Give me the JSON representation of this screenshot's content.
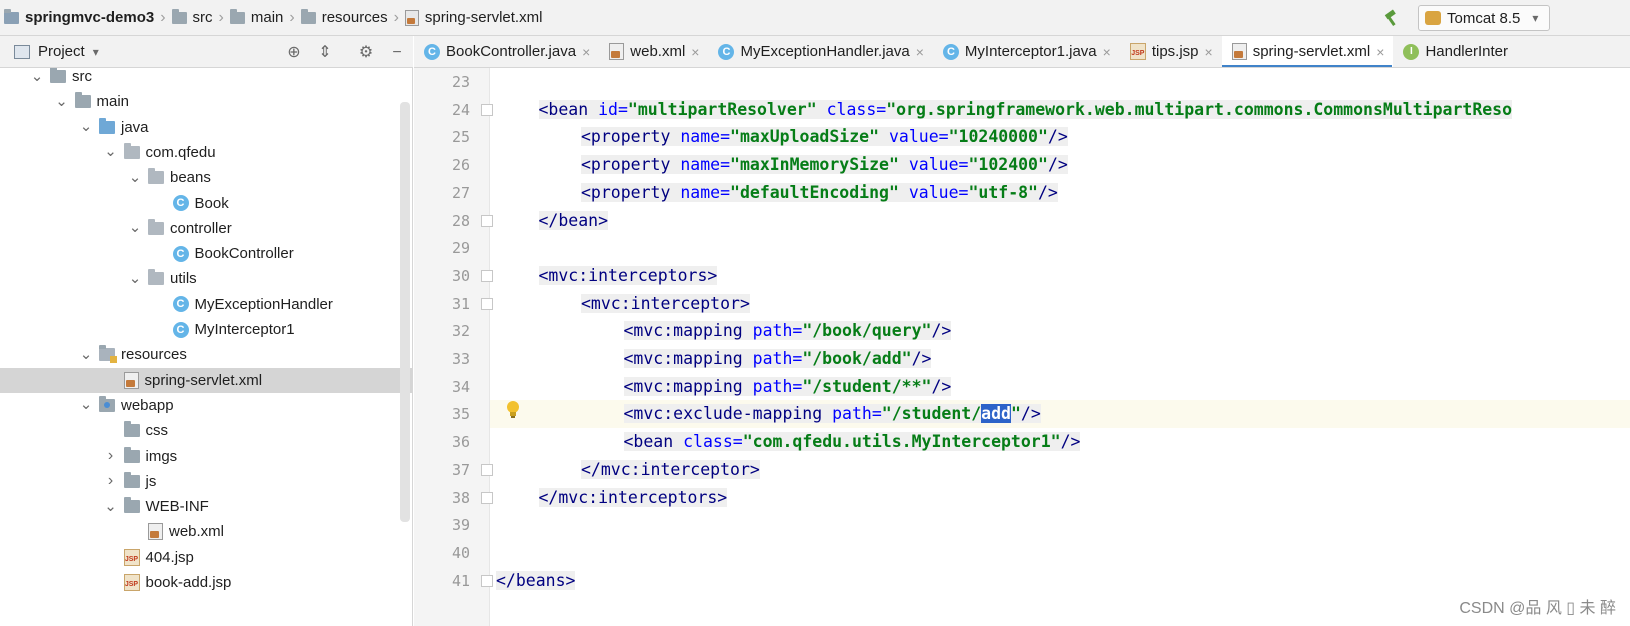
{
  "breadcrumb": {
    "project": "springmvc-demo3",
    "items": [
      "src",
      "main",
      "resources",
      "spring-servlet.xml"
    ]
  },
  "run_config": {
    "label": "Tomcat 8.5"
  },
  "project_panel": {
    "title": "Project"
  },
  "tree": [
    {
      "label": "src",
      "depth": 0,
      "icon": "folder",
      "arrow": "expanded"
    },
    {
      "label": "main",
      "depth": 1,
      "icon": "folder",
      "arrow": "expanded"
    },
    {
      "label": "java",
      "depth": 2,
      "icon": "source-folder",
      "arrow": "expanded"
    },
    {
      "label": "com.qfedu",
      "depth": 3,
      "icon": "package",
      "arrow": "expanded"
    },
    {
      "label": "beans",
      "depth": 4,
      "icon": "package",
      "arrow": "expanded"
    },
    {
      "label": "Book",
      "depth": 5,
      "icon": "class",
      "arrow": "none"
    },
    {
      "label": "controller",
      "depth": 4,
      "icon": "package",
      "arrow": "expanded"
    },
    {
      "label": "BookController",
      "depth": 5,
      "icon": "class",
      "arrow": "none"
    },
    {
      "label": "utils",
      "depth": 4,
      "icon": "package",
      "arrow": "expanded"
    },
    {
      "label": "MyExceptionHandler",
      "depth": 5,
      "icon": "class",
      "arrow": "none"
    },
    {
      "label": "MyInterceptor1",
      "depth": 5,
      "icon": "class",
      "arrow": "none"
    },
    {
      "label": "resources",
      "depth": 2,
      "icon": "resources-folder",
      "arrow": "expanded"
    },
    {
      "label": "spring-servlet.xml",
      "depth": 3,
      "icon": "xml",
      "arrow": "none",
      "selected": true
    },
    {
      "label": "webapp",
      "depth": 2,
      "icon": "web-folder",
      "arrow": "expanded"
    },
    {
      "label": "css",
      "depth": 3,
      "icon": "folder",
      "arrow": "none"
    },
    {
      "label": "imgs",
      "depth": 3,
      "icon": "folder",
      "arrow": "collapsed"
    },
    {
      "label": "js",
      "depth": 3,
      "icon": "folder",
      "arrow": "collapsed"
    },
    {
      "label": "WEB-INF",
      "depth": 3,
      "icon": "folder",
      "arrow": "expanded"
    },
    {
      "label": "web.xml",
      "depth": 4,
      "icon": "xml",
      "arrow": "none"
    },
    {
      "label": "404.jsp",
      "depth": 3,
      "icon": "jsp",
      "arrow": "none"
    },
    {
      "label": "book-add.jsp",
      "depth": 3,
      "icon": "jsp",
      "arrow": "none"
    }
  ],
  "tabs": [
    {
      "label": "BookController.java",
      "icon": "class",
      "closable": true
    },
    {
      "label": "web.xml",
      "icon": "xml",
      "closable": true
    },
    {
      "label": "MyExceptionHandler.java",
      "icon": "class",
      "closable": true
    },
    {
      "label": "MyInterceptor1.java",
      "icon": "class",
      "closable": true
    },
    {
      "label": "tips.jsp",
      "icon": "jsp",
      "closable": true
    },
    {
      "label": "spring-servlet.xml",
      "icon": "xml",
      "closable": true,
      "active": true
    },
    {
      "label": "HandlerInter",
      "icon": "interface",
      "closable": false
    }
  ],
  "editor": {
    "current_line": 35,
    "lines": [
      {
        "n": "23",
        "indent": 0,
        "tokens": []
      },
      {
        "n": "24",
        "indent": 1,
        "tokens": [
          [
            "t",
            "<bean "
          ],
          [
            "a",
            "id="
          ],
          [
            "v",
            "\"multipartResolver\""
          ],
          [
            "p",
            " "
          ],
          [
            "a",
            "class="
          ],
          [
            "v",
            "\"org.springframework.web.multipart.commons.CommonsMultipartReso"
          ]
        ]
      },
      {
        "n": "25",
        "indent": 2,
        "tokens": [
          [
            "t",
            "<property "
          ],
          [
            "a",
            "name="
          ],
          [
            "v",
            "\"maxUploadSize\""
          ],
          [
            "p",
            " "
          ],
          [
            "a",
            "value="
          ],
          [
            "v",
            "\"10240000\""
          ],
          [
            "t",
            "/>"
          ]
        ]
      },
      {
        "n": "26",
        "indent": 2,
        "tokens": [
          [
            "t",
            "<property "
          ],
          [
            "a",
            "name="
          ],
          [
            "v",
            "\"maxInMemorySize\""
          ],
          [
            "p",
            " "
          ],
          [
            "a",
            "value="
          ],
          [
            "v",
            "\"102400\""
          ],
          [
            "t",
            "/>"
          ]
        ]
      },
      {
        "n": "27",
        "indent": 2,
        "tokens": [
          [
            "t",
            "<property "
          ],
          [
            "a",
            "name="
          ],
          [
            "v",
            "\"defaultEncoding\""
          ],
          [
            "p",
            " "
          ],
          [
            "a",
            "value="
          ],
          [
            "v",
            "\"utf-8\""
          ],
          [
            "t",
            "/>"
          ]
        ]
      },
      {
        "n": "28",
        "indent": 1,
        "tokens": [
          [
            "t",
            "</bean>"
          ]
        ]
      },
      {
        "n": "29",
        "indent": 0,
        "tokens": []
      },
      {
        "n": "30",
        "indent": 1,
        "tokens": [
          [
            "t",
            "<mvc:interceptors>"
          ]
        ]
      },
      {
        "n": "31",
        "indent": 2,
        "tokens": [
          [
            "t",
            "<mvc:interceptor>"
          ]
        ]
      },
      {
        "n": "32",
        "indent": 3,
        "tokens": [
          [
            "t",
            "<mvc:mapping "
          ],
          [
            "a",
            "path="
          ],
          [
            "v",
            "\"/book/query\""
          ],
          [
            "t",
            "/>"
          ]
        ]
      },
      {
        "n": "33",
        "indent": 3,
        "tokens": [
          [
            "t",
            "<mvc:mapping "
          ],
          [
            "a",
            "path="
          ],
          [
            "v",
            "\"/book/add\""
          ],
          [
            "t",
            "/>"
          ]
        ]
      },
      {
        "n": "34",
        "indent": 3,
        "tokens": [
          [
            "t",
            "<mvc:mapping "
          ],
          [
            "a",
            "path="
          ],
          [
            "v",
            "\"/student/**\""
          ],
          [
            "t",
            "/>"
          ]
        ]
      },
      {
        "n": "35",
        "indent": 3,
        "tokens": [
          [
            "t",
            "<mvc:exclude-mapping "
          ],
          [
            "a",
            "path="
          ],
          [
            "v",
            "\"/student/"
          ],
          [
            "s",
            "add"
          ],
          [
            "v",
            "\""
          ],
          [
            "t",
            "/>"
          ]
        ]
      },
      {
        "n": "36",
        "indent": 3,
        "tokens": [
          [
            "t",
            "<bean "
          ],
          [
            "a",
            "class="
          ],
          [
            "v",
            "\"com.qfedu.utils.MyInterceptor1\""
          ],
          [
            "t",
            "/>"
          ]
        ]
      },
      {
        "n": "37",
        "indent": 2,
        "tokens": [
          [
            "t",
            "</mvc:interceptor>"
          ]
        ]
      },
      {
        "n": "38",
        "indent": 1,
        "tokens": [
          [
            "t",
            "</mvc:interceptors>"
          ]
        ]
      },
      {
        "n": "39",
        "indent": 0,
        "tokens": []
      },
      {
        "n": "40",
        "indent": 0,
        "tokens": []
      },
      {
        "n": "41",
        "indent": 0,
        "tokens": [
          [
            "t",
            "</beans>"
          ]
        ]
      }
    ]
  },
  "watermark": "CSDN @品 风 ▯ 未 醉",
  "colors": {
    "tag": "#000080",
    "attr": "#0000ff",
    "value": "#067d17",
    "selection": "#2d63c9",
    "active_tab_underline": "#4083c9"
  }
}
